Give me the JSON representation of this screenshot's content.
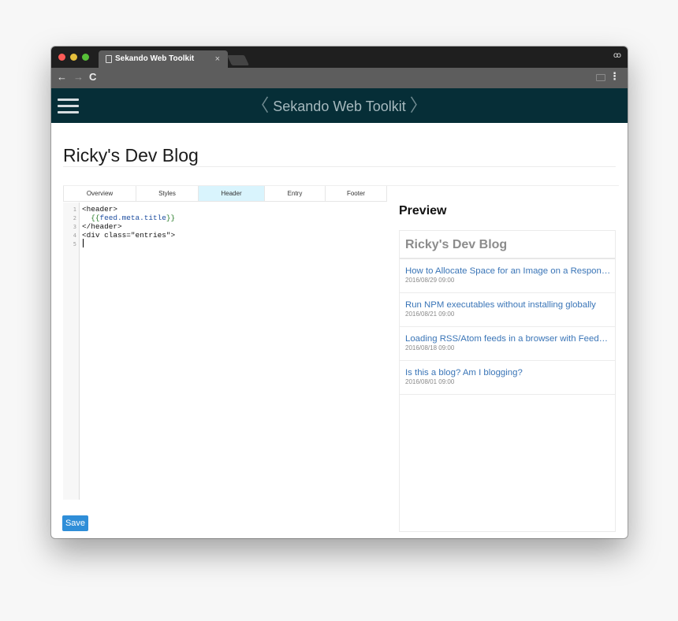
{
  "browser": {
    "tab_title": "Sekando Web Toolkit",
    "tab_close": "×",
    "back": "←",
    "forward": "→",
    "reload": "C",
    "incognito_icon": "ꝏ",
    "menu": "⋮",
    "icons": [
      "doc-icon",
      "incognito-icon",
      "cast-icon",
      "kebab-menu-icon"
    ]
  },
  "app": {
    "title": "Sekando Web Toolkit",
    "chevron_left": "〈",
    "chevron_right": "〉",
    "colors": {
      "header_bg": "#062e37",
      "header_text": "#a6b9be",
      "accent": "#2f8ed8",
      "active_tab": "#d9f4fd"
    }
  },
  "page": {
    "title": "Ricky's Dev Blog"
  },
  "editor": {
    "tabs": [
      {
        "label": "Overview",
        "active": false
      },
      {
        "label": "Styles",
        "active": false
      },
      {
        "label": "Header",
        "active": true
      },
      {
        "label": "Entry",
        "active": false
      },
      {
        "label": "Footer",
        "active": false
      }
    ],
    "line_numbers": [
      "1",
      "2",
      "3",
      "4",
      "5"
    ],
    "lines": {
      "l1": "<header>",
      "l2_indent": "  ",
      "l2_open": "{{",
      "l2_var": "feed.meta.title",
      "l2_close": "}}",
      "l3": "</header>",
      "l4": "<div class=\"entries\">",
      "l5": ""
    }
  },
  "save_label": "Save",
  "preview": {
    "heading": "Preview",
    "blog_title": "Ricky's Dev Blog",
    "entries": [
      {
        "title": "How to Allocate Space for an Image on a Responsive Page",
        "date": "2016/08/29 09:00"
      },
      {
        "title": "Run NPM executables without installing globally",
        "date": "2016/08/21 09:00"
      },
      {
        "title": "Loading RSS/Atom feeds in a browser with Feedparser",
        "date": "2016/08/18 09:00"
      },
      {
        "title": "Is this a blog? Am I blogging?",
        "date": "2016/08/01 09:00"
      }
    ]
  }
}
